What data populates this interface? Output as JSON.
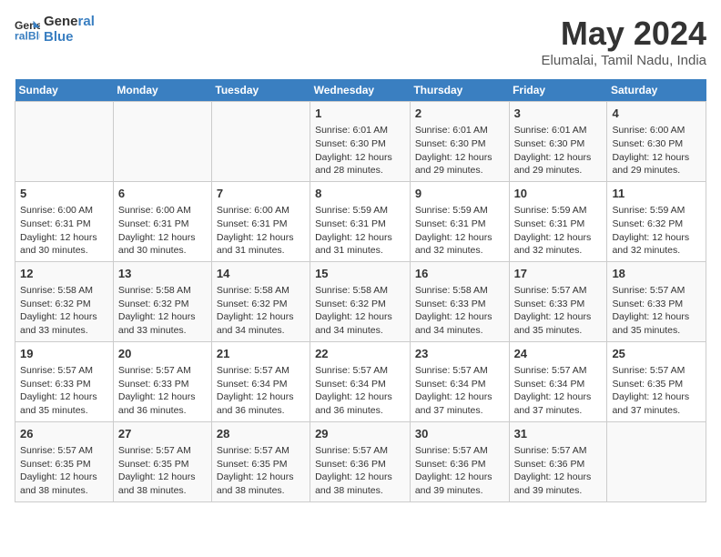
{
  "header": {
    "logo_line1": "General",
    "logo_line2": "Blue",
    "month_year": "May 2024",
    "location": "Elumalai, Tamil Nadu, India"
  },
  "days_of_week": [
    "Sunday",
    "Monday",
    "Tuesday",
    "Wednesday",
    "Thursday",
    "Friday",
    "Saturday"
  ],
  "weeks": [
    [
      {
        "day": "",
        "content": ""
      },
      {
        "day": "",
        "content": ""
      },
      {
        "day": "",
        "content": ""
      },
      {
        "day": "1",
        "content": "Sunrise: 6:01 AM\nSunset: 6:30 PM\nDaylight: 12 hours\nand 28 minutes."
      },
      {
        "day": "2",
        "content": "Sunrise: 6:01 AM\nSunset: 6:30 PM\nDaylight: 12 hours\nand 29 minutes."
      },
      {
        "day": "3",
        "content": "Sunrise: 6:01 AM\nSunset: 6:30 PM\nDaylight: 12 hours\nand 29 minutes."
      },
      {
        "day": "4",
        "content": "Sunrise: 6:00 AM\nSunset: 6:30 PM\nDaylight: 12 hours\nand 29 minutes."
      }
    ],
    [
      {
        "day": "5",
        "content": "Sunrise: 6:00 AM\nSunset: 6:31 PM\nDaylight: 12 hours\nand 30 minutes."
      },
      {
        "day": "6",
        "content": "Sunrise: 6:00 AM\nSunset: 6:31 PM\nDaylight: 12 hours\nand 30 minutes."
      },
      {
        "day": "7",
        "content": "Sunrise: 6:00 AM\nSunset: 6:31 PM\nDaylight: 12 hours\nand 31 minutes."
      },
      {
        "day": "8",
        "content": "Sunrise: 5:59 AM\nSunset: 6:31 PM\nDaylight: 12 hours\nand 31 minutes."
      },
      {
        "day": "9",
        "content": "Sunrise: 5:59 AM\nSunset: 6:31 PM\nDaylight: 12 hours\nand 32 minutes."
      },
      {
        "day": "10",
        "content": "Sunrise: 5:59 AM\nSunset: 6:31 PM\nDaylight: 12 hours\nand 32 minutes."
      },
      {
        "day": "11",
        "content": "Sunrise: 5:59 AM\nSunset: 6:32 PM\nDaylight: 12 hours\nand 32 minutes."
      }
    ],
    [
      {
        "day": "12",
        "content": "Sunrise: 5:58 AM\nSunset: 6:32 PM\nDaylight: 12 hours\nand 33 minutes."
      },
      {
        "day": "13",
        "content": "Sunrise: 5:58 AM\nSunset: 6:32 PM\nDaylight: 12 hours\nand 33 minutes."
      },
      {
        "day": "14",
        "content": "Sunrise: 5:58 AM\nSunset: 6:32 PM\nDaylight: 12 hours\nand 34 minutes."
      },
      {
        "day": "15",
        "content": "Sunrise: 5:58 AM\nSunset: 6:32 PM\nDaylight: 12 hours\nand 34 minutes."
      },
      {
        "day": "16",
        "content": "Sunrise: 5:58 AM\nSunset: 6:33 PM\nDaylight: 12 hours\nand 34 minutes."
      },
      {
        "day": "17",
        "content": "Sunrise: 5:57 AM\nSunset: 6:33 PM\nDaylight: 12 hours\nand 35 minutes."
      },
      {
        "day": "18",
        "content": "Sunrise: 5:57 AM\nSunset: 6:33 PM\nDaylight: 12 hours\nand 35 minutes."
      }
    ],
    [
      {
        "day": "19",
        "content": "Sunrise: 5:57 AM\nSunset: 6:33 PM\nDaylight: 12 hours\nand 35 minutes."
      },
      {
        "day": "20",
        "content": "Sunrise: 5:57 AM\nSunset: 6:33 PM\nDaylight: 12 hours\nand 36 minutes."
      },
      {
        "day": "21",
        "content": "Sunrise: 5:57 AM\nSunset: 6:34 PM\nDaylight: 12 hours\nand 36 minutes."
      },
      {
        "day": "22",
        "content": "Sunrise: 5:57 AM\nSunset: 6:34 PM\nDaylight: 12 hours\nand 36 minutes."
      },
      {
        "day": "23",
        "content": "Sunrise: 5:57 AM\nSunset: 6:34 PM\nDaylight: 12 hours\nand 37 minutes."
      },
      {
        "day": "24",
        "content": "Sunrise: 5:57 AM\nSunset: 6:34 PM\nDaylight: 12 hours\nand 37 minutes."
      },
      {
        "day": "25",
        "content": "Sunrise: 5:57 AM\nSunset: 6:35 PM\nDaylight: 12 hours\nand 37 minutes."
      }
    ],
    [
      {
        "day": "26",
        "content": "Sunrise: 5:57 AM\nSunset: 6:35 PM\nDaylight: 12 hours\nand 38 minutes."
      },
      {
        "day": "27",
        "content": "Sunrise: 5:57 AM\nSunset: 6:35 PM\nDaylight: 12 hours\nand 38 minutes."
      },
      {
        "day": "28",
        "content": "Sunrise: 5:57 AM\nSunset: 6:35 PM\nDaylight: 12 hours\nand 38 minutes."
      },
      {
        "day": "29",
        "content": "Sunrise: 5:57 AM\nSunset: 6:36 PM\nDaylight: 12 hours\nand 38 minutes."
      },
      {
        "day": "30",
        "content": "Sunrise: 5:57 AM\nSunset: 6:36 PM\nDaylight: 12 hours\nand 39 minutes."
      },
      {
        "day": "31",
        "content": "Sunrise: 5:57 AM\nSunset: 6:36 PM\nDaylight: 12 hours\nand 39 minutes."
      },
      {
        "day": "",
        "content": ""
      }
    ]
  ]
}
